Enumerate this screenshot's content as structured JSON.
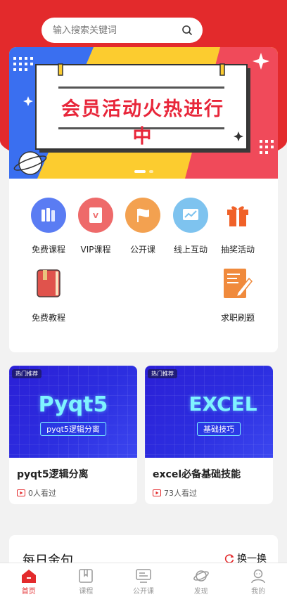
{
  "search": {
    "placeholder": "输入搜索关键词"
  },
  "banner": {
    "title": "会员活动火热进行中"
  },
  "menu": {
    "items": [
      {
        "label": "免费课程",
        "icon": "books-icon",
        "color": "#5a7cf3"
      },
      {
        "label": "VIP课程",
        "icon": "vip-book-icon",
        "color": "#ee6a6a"
      },
      {
        "label": "公开课",
        "icon": "flag-icon",
        "color": "#f3a150"
      },
      {
        "label": "线上互动",
        "icon": "chart-screen-icon",
        "color": "#7ec3ef"
      },
      {
        "label": "抽奖活动",
        "icon": "gift-icon",
        "color": "#f06128"
      },
      {
        "label": "免费教程",
        "icon": "notebook-icon",
        "color": "#e0534c"
      },
      {
        "label": "求职刷题",
        "icon": "document-pen-icon",
        "color": "#f08a3c"
      }
    ]
  },
  "courses": [
    {
      "tag": "热门推荐",
      "thumb_title": "Pyqt5",
      "thumb_subtitle": "pyqt5逻辑分离",
      "title": "pyqt5逻辑分离",
      "views": "0人看过"
    },
    {
      "tag": "热门推荐",
      "thumb_title": "EXCEL",
      "thumb_subtitle": "基础技巧",
      "title": "excel必备基础技能",
      "views": "73人看过"
    }
  ],
  "quote": {
    "title": "每日金句",
    "refresh_label": "换一换"
  },
  "tabbar": {
    "tabs": [
      {
        "label": "首页",
        "icon": "home-icon",
        "active": true
      },
      {
        "label": "课程",
        "icon": "course-icon",
        "active": false
      },
      {
        "label": "公开课",
        "icon": "screen-icon",
        "active": false
      },
      {
        "label": "发现",
        "icon": "planet-icon",
        "active": false
      },
      {
        "label": "我的",
        "icon": "user-icon",
        "active": false
      }
    ]
  },
  "colors": {
    "brand": "#e32a2c",
    "accent_text": "#7ff3ff"
  }
}
